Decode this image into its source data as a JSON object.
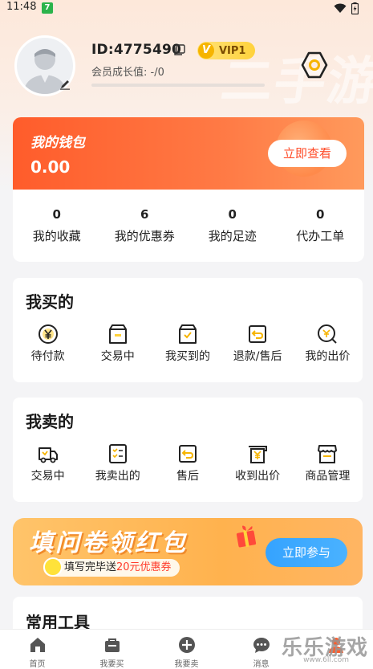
{
  "status_bar": {
    "time": "11:48",
    "badge": "7"
  },
  "background_watermark": "二手游",
  "profile": {
    "id_text": "ID:4775490",
    "vip_label": "VIP1",
    "vip_letter": "V",
    "growth_label": "会员成长值: -/0"
  },
  "wallet": {
    "title": "我的钱包",
    "amount": "0.00",
    "button": "立即查看",
    "stats": [
      {
        "value": "0",
        "label": "我的收藏"
      },
      {
        "value": "6",
        "label": "我的优惠券"
      },
      {
        "value": "0",
        "label": "我的足迹"
      },
      {
        "value": "0",
        "label": "代办工单"
      }
    ]
  },
  "buy_section": {
    "title": "我买的",
    "items": [
      {
        "label": "待付款",
        "icon": "yen-circle-icon"
      },
      {
        "label": "交易中",
        "icon": "box-icon"
      },
      {
        "label": "我买到的",
        "icon": "box-check-icon"
      },
      {
        "label": "退款/售后",
        "icon": "return-icon"
      },
      {
        "label": "我的出价",
        "icon": "bid-icon"
      }
    ]
  },
  "sell_section": {
    "title": "我卖的",
    "items": [
      {
        "label": "交易中",
        "icon": "truck-icon"
      },
      {
        "label": "我卖出的",
        "icon": "checklist-icon"
      },
      {
        "label": "售后",
        "icon": "return-icon"
      },
      {
        "label": "收到出价",
        "icon": "yen-receipt-icon"
      },
      {
        "label": "商品管理",
        "icon": "store-icon"
      }
    ]
  },
  "banner": {
    "title": "填问卷领红包",
    "sub_prefix": "填写完毕送",
    "sub_highlight": "20元优惠券",
    "button": "立即参与"
  },
  "tools": {
    "title": "常用工具"
  },
  "bottom_nav": [
    {
      "label": "首页",
      "icon": "home-icon"
    },
    {
      "label": "我要买",
      "icon": "bag-icon"
    },
    {
      "label": "我要卖",
      "icon": "plus-circle-icon"
    },
    {
      "label": "消息",
      "icon": "message-icon"
    },
    {
      "label": "",
      "icon": "profile-icon"
    }
  ],
  "site_watermark": {
    "name": "乐乐游戏",
    "url": "www.6ll.com"
  },
  "colors": {
    "accent": "#ff5c2b",
    "blue": "#3aa8ff",
    "vip": "#ffd23b"
  }
}
